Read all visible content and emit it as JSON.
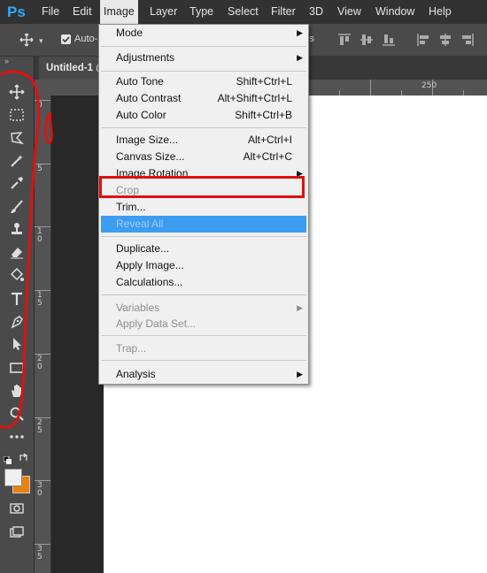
{
  "app": {
    "logo": "Ps",
    "brand_color": "#31a8ff"
  },
  "menubar": {
    "items": [
      {
        "label": "File"
      },
      {
        "label": "Edit"
      },
      {
        "label": "Image"
      },
      {
        "label": "Layer"
      },
      {
        "label": "Type"
      },
      {
        "label": "Select"
      },
      {
        "label": "Filter"
      },
      {
        "label": "3D"
      },
      {
        "label": "View"
      },
      {
        "label": "Window"
      },
      {
        "label": "Help"
      }
    ],
    "active": "Image"
  },
  "options_bar": {
    "auto_select_label": "Auto-S",
    "trailing_label": "ls"
  },
  "document": {
    "tab_title": "Untitled-1 @"
  },
  "ruler": {
    "horizontal": [
      "250"
    ],
    "vertical": [
      "0",
      "5",
      "1 0",
      "1 5",
      "2 0",
      "2 5",
      "3 0",
      "3 5"
    ]
  },
  "image_menu": {
    "items": [
      {
        "label": "Mode",
        "shortcut": "",
        "submenu": true,
        "enabled": true
      },
      {
        "label": "Adjustments",
        "shortcut": "",
        "submenu": true,
        "enabled": true
      },
      {
        "label": "Auto Tone",
        "shortcut": "Shift+Ctrl+L",
        "submenu": false,
        "enabled": true
      },
      {
        "label": "Auto Contrast",
        "shortcut": "Alt+Shift+Ctrl+L",
        "submenu": false,
        "enabled": true
      },
      {
        "label": "Auto Color",
        "shortcut": "Shift+Ctrl+B",
        "submenu": false,
        "enabled": true
      },
      {
        "label": "Image Size...",
        "shortcut": "Alt+Ctrl+I",
        "submenu": false,
        "enabled": true
      },
      {
        "label": "Canvas Size...",
        "shortcut": "Alt+Ctrl+C",
        "submenu": false,
        "enabled": true
      },
      {
        "label": "Image Rotation",
        "shortcut": "",
        "submenu": true,
        "enabled": true
      },
      {
        "label": "Crop",
        "shortcut": "",
        "submenu": false,
        "enabled": false
      },
      {
        "label": "Trim...",
        "shortcut": "",
        "submenu": false,
        "enabled": true
      },
      {
        "label": "Reveal All",
        "shortcut": "",
        "submenu": false,
        "enabled": false,
        "highlighted": true
      },
      {
        "label": "Duplicate...",
        "shortcut": "",
        "submenu": false,
        "enabled": true
      },
      {
        "label": "Apply Image...",
        "shortcut": "",
        "submenu": false,
        "enabled": true
      },
      {
        "label": "Calculations...",
        "shortcut": "",
        "submenu": false,
        "enabled": true
      },
      {
        "label": "Variables",
        "shortcut": "",
        "submenu": true,
        "enabled": false
      },
      {
        "label": "Apply Data Set...",
        "shortcut": "",
        "submenu": false,
        "enabled": false
      },
      {
        "label": "Trap...",
        "shortcut": "",
        "submenu": false,
        "enabled": false
      },
      {
        "label": "Analysis",
        "shortcut": "",
        "submenu": true,
        "enabled": true
      }
    ],
    "highlight_color": "#3c9cf0"
  },
  "annotation": {
    "color": "#e01010"
  },
  "colors": {
    "foreground": "#f0f0f0",
    "background": "#e8820c"
  }
}
